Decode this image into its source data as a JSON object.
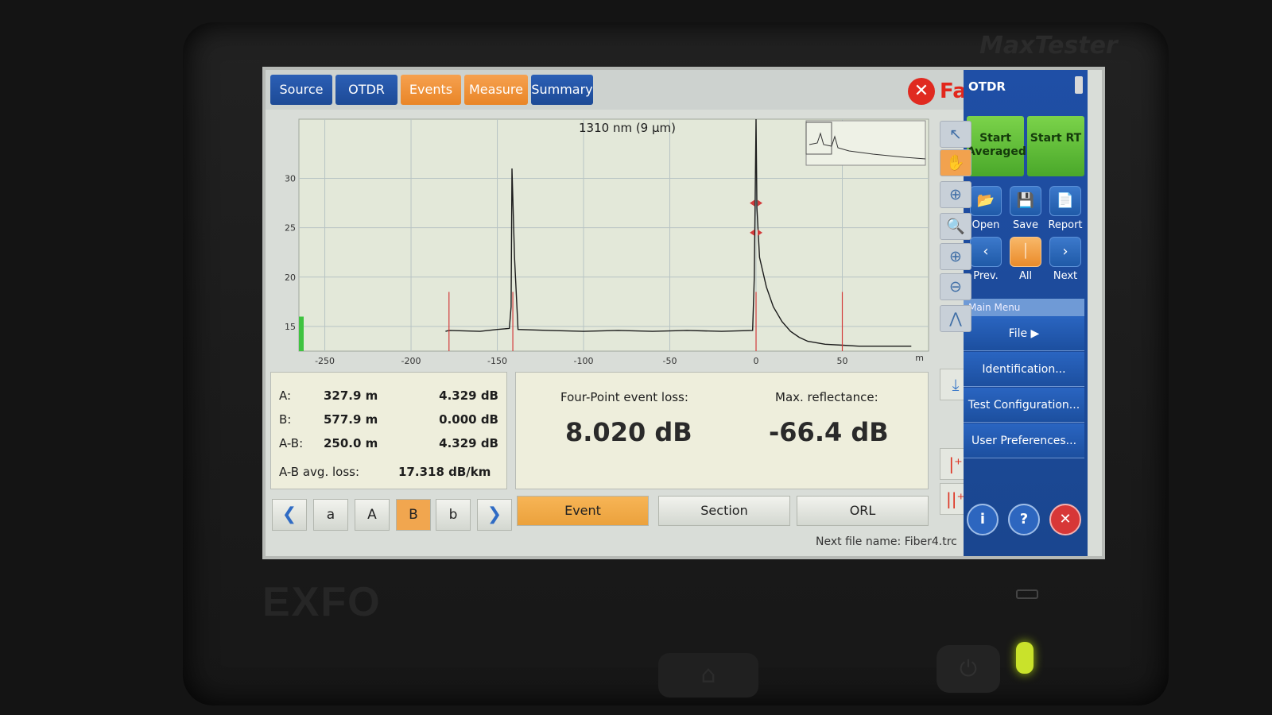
{
  "device": {
    "brand_top": "MaxTester",
    "brand_bottom": "EXFO"
  },
  "tabs": [
    {
      "label": "Source"
    },
    {
      "label": "OTDR"
    },
    {
      "label": "Events"
    },
    {
      "label": "Measure",
      "active": true
    },
    {
      "label": "Summary"
    }
  ],
  "status": {
    "label": "Fail",
    "color": "#e2271c",
    "icon": "fail-x-icon"
  },
  "chart_data": {
    "type": "line",
    "title": "1310 nm (9 µm)",
    "xlabel": "m",
    "ylabel": "",
    "xlim": [
      -265,
      100
    ],
    "ylim": [
      12.5,
      36
    ],
    "x_ticks": [
      -250,
      -200,
      -150,
      -100,
      -50,
      0,
      50
    ],
    "y_ticks": [
      15,
      20,
      25,
      30
    ],
    "grid": true,
    "series": [
      {
        "x": [
          -180,
          -178,
          -160,
          -150,
          -143,
          -142,
          -141.5,
          -140,
          -138,
          -120,
          -100,
          -80,
          -60,
          -40,
          -20,
          -2,
          -1,
          0,
          0.5,
          2,
          6,
          10,
          15,
          20,
          25,
          30,
          40,
          50,
          60,
          70,
          90
        ],
        "y": [
          14.5,
          14.6,
          14.5,
          14.7,
          14.8,
          17,
          31,
          22,
          14.7,
          14.6,
          14.5,
          14.6,
          14.5,
          14.6,
          14.5,
          14.6,
          20,
          36,
          27,
          22,
          19,
          17,
          15.5,
          14.5,
          13.9,
          13.5,
          13.2,
          13.1,
          13.0,
          13.0,
          13.0
        ]
      }
    ],
    "markers": [
      {
        "label": "a",
        "x": -178
      },
      {
        "label": "A",
        "x": -141
      },
      {
        "label": "B",
        "x": 0
      },
      {
        "label": "b",
        "x": 50
      }
    ]
  },
  "tools": [
    {
      "name": "pointer-icon",
      "glyph": "↖"
    },
    {
      "name": "pan-hand-icon",
      "glyph": "✋",
      "active": true
    },
    {
      "name": "zoom-area-icon",
      "glyph": "⊕"
    },
    {
      "name": "zoom-full-icon",
      "glyph": "🔍"
    },
    {
      "name": "zoom-in-icon",
      "glyph": "⊕"
    },
    {
      "name": "zoom-out-icon",
      "glyph": "⊖"
    },
    {
      "name": "fit-trace-icon",
      "glyph": "⋀"
    }
  ],
  "measure": {
    "a_label": "A:",
    "a_distance": "327.9 m",
    "a_loss": "4.329 dB",
    "b_label": "B:",
    "b_distance": "577.9 m",
    "b_loss": "0.000 dB",
    "ab_label": "A-B:",
    "ab_distance": "250.0 m",
    "ab_loss": "4.329 dB",
    "avg_label": "A-B avg. loss:",
    "avg_value": "17.318 dB/km"
  },
  "event": {
    "loss_label": "Four-Point event loss:",
    "loss_value": "8.020 dB",
    "refl_label": "Max. reflectance:",
    "refl_value": "-66.4 dB"
  },
  "marker_nav": [
    {
      "label": "❮",
      "arrow": true
    },
    {
      "label": "a"
    },
    {
      "label": "A"
    },
    {
      "label": "B",
      "active": true
    },
    {
      "label": "b"
    },
    {
      "label": "❯",
      "arrow": true
    }
  ],
  "modes": [
    {
      "label": "Event",
      "active": true
    },
    {
      "label": "Section"
    },
    {
      "label": "ORL"
    }
  ],
  "next_file": "Next file name: Fiber4.trc",
  "right_panel": {
    "title": "OTDR",
    "start_averaged": "Start Averaged",
    "start_rt": "Start RT",
    "icons": [
      {
        "label": "Open",
        "name": "open-folder-icon",
        "glyph": "📂"
      },
      {
        "label": "Save",
        "name": "save-disk-icon",
        "glyph": "💾"
      },
      {
        "label": "Report",
        "name": "report-icon",
        "glyph": "📄"
      },
      {
        "label": "Prev.",
        "name": "prev-icon",
        "glyph": "‹"
      },
      {
        "label": "All",
        "name": "all-trace-icon",
        "glyph": "⏐",
        "active": true
      },
      {
        "label": "Next",
        "name": "next-icon",
        "glyph": "›"
      }
    ],
    "main_menu": "Main Menu",
    "menu": [
      {
        "label": "File  ▶"
      },
      {
        "label": "Identification..."
      },
      {
        "label": "Test Configuration..."
      },
      {
        "label": "User Preferences..."
      }
    ]
  }
}
